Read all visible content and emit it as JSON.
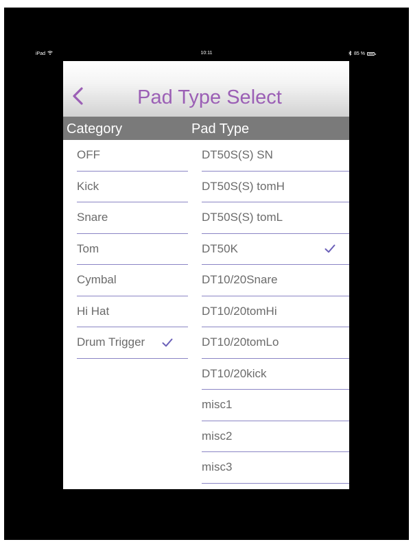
{
  "status_bar": {
    "device": "iPad",
    "time": "10:11",
    "battery": "85 %"
  },
  "nav": {
    "title": "Pad Type Select"
  },
  "header": {
    "category": "Category",
    "pad_type": "Pad Type"
  },
  "categories": [
    {
      "label": "OFF",
      "selected": false
    },
    {
      "label": "Kick",
      "selected": false
    },
    {
      "label": "Snare",
      "selected": false
    },
    {
      "label": "Tom",
      "selected": false
    },
    {
      "label": "Cymbal",
      "selected": false
    },
    {
      "label": "Hi Hat",
      "selected": false
    },
    {
      "label": "Drum Trigger",
      "selected": true
    }
  ],
  "pad_types": [
    {
      "label": "DT50S(S) SN",
      "selected": false
    },
    {
      "label": "DT50S(S) tomH",
      "selected": false
    },
    {
      "label": "DT50S(S) tomL",
      "selected": false
    },
    {
      "label": "DT50K",
      "selected": true
    },
    {
      "label": "DT10/20Snare",
      "selected": false
    },
    {
      "label": "DT10/20tomHi",
      "selected": false
    },
    {
      "label": "DT10/20tomLo",
      "selected": false
    },
    {
      "label": "DT10/20kick",
      "selected": false
    },
    {
      "label": "misc1",
      "selected": false
    },
    {
      "label": "misc2",
      "selected": false
    },
    {
      "label": "misc3",
      "selected": false
    }
  ],
  "colors": {
    "accent": "#9b5fb5",
    "check": "#6a5fb8",
    "separator": "#8a84c4",
    "header_bg": "#7a7a7a"
  },
  "icons": {
    "back": "chevron-left-icon",
    "selected": "checkmark-icon",
    "wifi": "wifi-icon",
    "bluetooth": "bluetooth-icon",
    "battery": "battery-icon"
  }
}
